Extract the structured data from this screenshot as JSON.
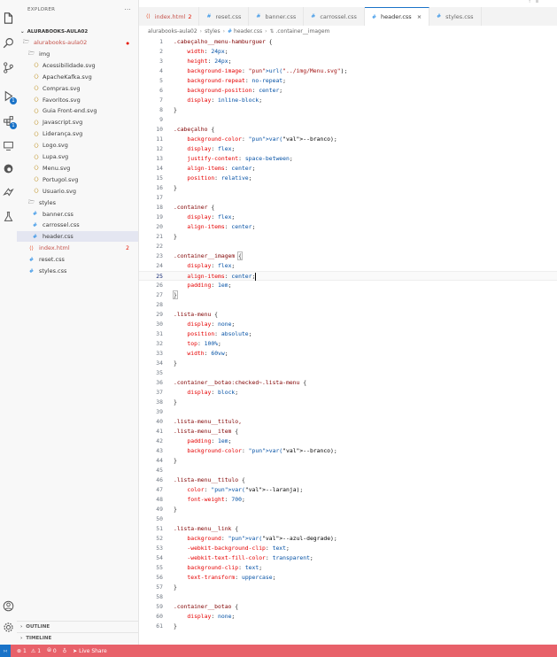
{
  "sidebar": {
    "title": "EXPLORER",
    "more": "···",
    "root": "ALURABOOKS-AULA02",
    "project_folder": "alurabooks-aula02",
    "img_folder": "img",
    "img_files": [
      "Acessibilidade.svg",
      "ApacheKafka.svg",
      "Compras.svg",
      "Favoritos.svg",
      "Guia Front-end.svg",
      "Javascript.svg",
      "Liderança.svg",
      "Logo.svg",
      "Lupa.svg",
      "Menu.svg",
      "Portugol.svg",
      "Usuario.svg"
    ],
    "styles_folder": "styles",
    "styles_files": [
      "banner.css",
      "carrossel.css",
      "header.css"
    ],
    "root_files": [
      "index.html",
      "reset.css",
      "styles.css"
    ],
    "index_count": "2",
    "outline": "OUTLINE",
    "timeline": "TIMELINE"
  },
  "tabs": [
    {
      "label": "index.html",
      "icon": "html-icon",
      "badge": "2"
    },
    {
      "label": "reset.css",
      "icon": "css-icon"
    },
    {
      "label": "banner.css",
      "icon": "css-icon"
    },
    {
      "label": "carrossel.css",
      "icon": "css-icon"
    },
    {
      "label": "header.css",
      "icon": "css-icon",
      "active": true
    },
    {
      "label": "styles.css",
      "icon": "css-icon"
    }
  ],
  "breadcrumb": [
    "alurabooks-aula02",
    "styles",
    "header.css",
    ".container__imagem"
  ],
  "editor": {
    "active_line": 25,
    "lines": [
      ".cabeçalho__menu-hamburguer {",
      "    width: 24px;",
      "    height: 24px;",
      "    background-image: url(\"../img/Menu.svg\");",
      "    background-repeat: no-repeat;",
      "    background-position: center;",
      "    display: inline-block;",
      "}",
      "",
      ".cabeçalho {",
      "    background-color: var(--branco);",
      "    display: flex;",
      "    justify-content: space-between;",
      "    align-items: center;",
      "    position: relative;",
      "}",
      "",
      ".container {",
      "    display: flex;",
      "    align-items: center;",
      "}",
      "",
      ".container__imagem {",
      "    display: flex;",
      "    align-items: center;",
      "    padding: 1em;",
      "}",
      "",
      ".lista-menu {",
      "    display: none;",
      "    position: absolute;",
      "    top: 100%;",
      "    width: 60vw;",
      "}",
      "",
      ".container__botao:checked~.lista-menu {",
      "    display: block;",
      "}",
      "",
      ".lista-menu__titulo,",
      ".lista-menu__item {",
      "    padding: 1em;",
      "    background-color: var(--branco);",
      "}",
      "",
      ".lista-menu__titulo {",
      "    color: var(--laranja);",
      "    font-weight: 700;",
      "}",
      "",
      ".lista-menu__link {",
      "    background: var(--azul-degrade);",
      "    -webkit-background-clip: text;",
      "    -webkit-text-fill-color: transparent;",
      "    background-clip: text;",
      "    text-transform: uppercase;",
      "}",
      "",
      ".container__botao {",
      "    display: none;",
      "}"
    ]
  },
  "status": {
    "errors": "1",
    "warnings": "1",
    "ports": "0",
    "live_share": "Live Share"
  },
  "colors": {
    "statusbar": "#e8616a",
    "accent": "#1a73c8",
    "selector": "#800000",
    "property": "#e50000",
    "value": "#0451a5"
  }
}
